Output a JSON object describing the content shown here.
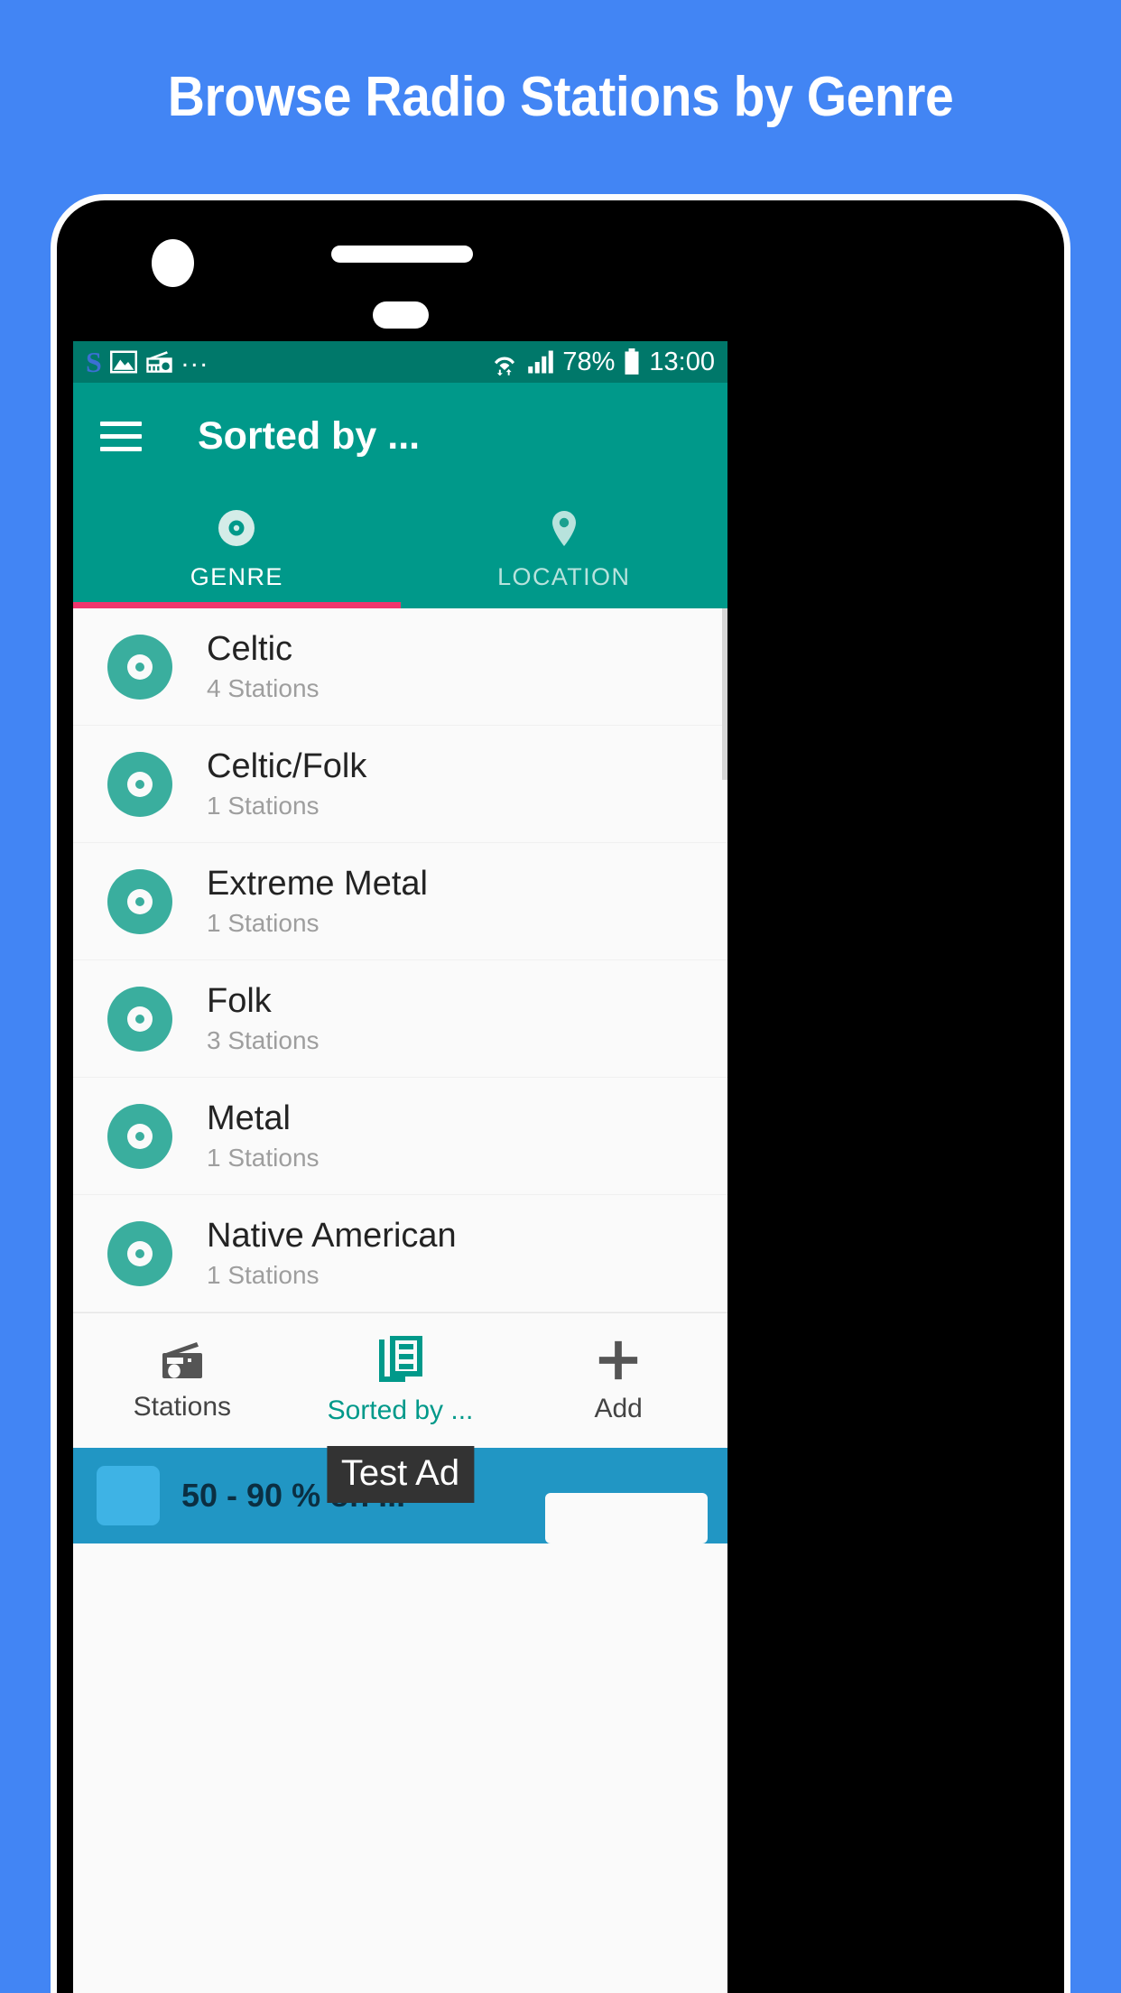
{
  "promo": {
    "headline": "Browse Radio Stations by Genre"
  },
  "status_bar": {
    "app_logo": "S",
    "notif_icons": [
      "s-logo-icon",
      "image-icon",
      "radio-icon"
    ],
    "overflow": "...",
    "wifi": "wifi-icon",
    "signal": "cellular-signal-icon",
    "battery_percent": "78%",
    "battery": "battery-icon",
    "clock": "13:00"
  },
  "app_bar": {
    "menu_icon": "hamburger-menu-icon",
    "title": "Sorted by ..."
  },
  "tabs": [
    {
      "label": "GENRE",
      "icon": "disc-icon",
      "active": true
    },
    {
      "label": "LOCATION",
      "icon": "location-pin-icon",
      "active": false
    }
  ],
  "genre_list": [
    {
      "name": "Celtic",
      "count": "4 Stations",
      "icon": "disc-icon"
    },
    {
      "name": "Celtic/Folk",
      "count": "1 Stations",
      "icon": "disc-icon"
    },
    {
      "name": "Extreme Metal",
      "count": "1 Stations",
      "icon": "disc-icon"
    },
    {
      "name": "Folk",
      "count": "3 Stations",
      "icon": "disc-icon"
    },
    {
      "name": "Metal",
      "count": "1 Stations",
      "icon": "disc-icon"
    },
    {
      "name": "Native American",
      "count": "1 Stations",
      "icon": "disc-icon"
    }
  ],
  "bottom_nav": [
    {
      "label": "Stations",
      "icon": "radio-icon",
      "active": false
    },
    {
      "label": "Sorted by ...",
      "icon": "list-stack-icon",
      "active": true
    },
    {
      "label": "Add",
      "icon": "plus-icon",
      "active": false
    }
  ],
  "ad": {
    "chip_label": "Test Ad",
    "text": "50 - 90 % on ...",
    "cta": ""
  },
  "colors": {
    "page_background": "#4285f4",
    "app_bar": "#00998a",
    "status_bar": "#00786a",
    "accent_pink": "#f1356d",
    "disc_teal": "#3aae9e",
    "ad_blue": "#2196c4"
  }
}
